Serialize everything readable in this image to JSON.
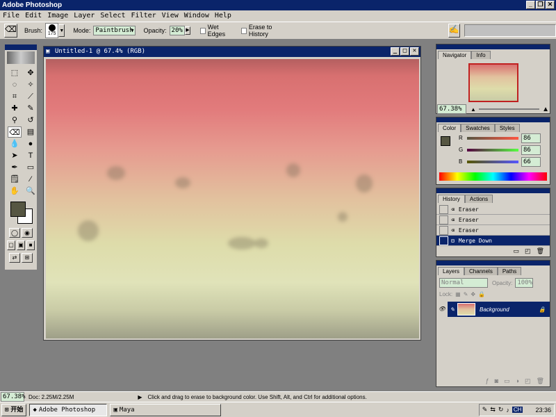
{
  "app": {
    "title": "Adobe Photoshop"
  },
  "menu": [
    "File",
    "Edit",
    "Image",
    "Layer",
    "Select",
    "Filter",
    "View",
    "Window",
    "Help"
  ],
  "options": {
    "brush_label": "Brush:",
    "brush_size": "175",
    "mode_label": "Mode:",
    "mode_value": "Paintbrush",
    "opacity_label": "Opacity:",
    "opacity_value": "20%",
    "wet_edges": "Wet Edges",
    "erase_history": "Erase to History"
  },
  "document": {
    "title": "Untitled-1 @ 67.4% (RGB)"
  },
  "navigator": {
    "tabs": [
      "Navigator",
      "Info"
    ],
    "zoom": "67.38%"
  },
  "color": {
    "tabs": [
      "Color",
      "Swatches",
      "Styles"
    ],
    "r": "86",
    "g": "86",
    "b": "66",
    "r_label": "R",
    "g_label": "G",
    "b_label": "B"
  },
  "history": {
    "tabs": [
      "History",
      "Actions"
    ],
    "items": [
      "Eraser",
      "Eraser",
      "Eraser",
      "Merge Down"
    ]
  },
  "layers": {
    "tabs": [
      "Layers",
      "Channels",
      "Paths"
    ],
    "blend": "Normal",
    "opacity_label": "Opacity:",
    "opacity": "100%",
    "lock_label": "Lock:",
    "layer_name": "Background"
  },
  "status": {
    "zoom": "67.38%",
    "doc": "Doc: 2.25M/2.25M",
    "hint": "Click and drag to erase to background color. Use Shift, Alt, and Ctrl for additional options."
  },
  "taskbar": {
    "start": "开始",
    "app1": "Adobe Photoshop",
    "app2": "Maya",
    "ime": "CH",
    "time": "23:36"
  }
}
